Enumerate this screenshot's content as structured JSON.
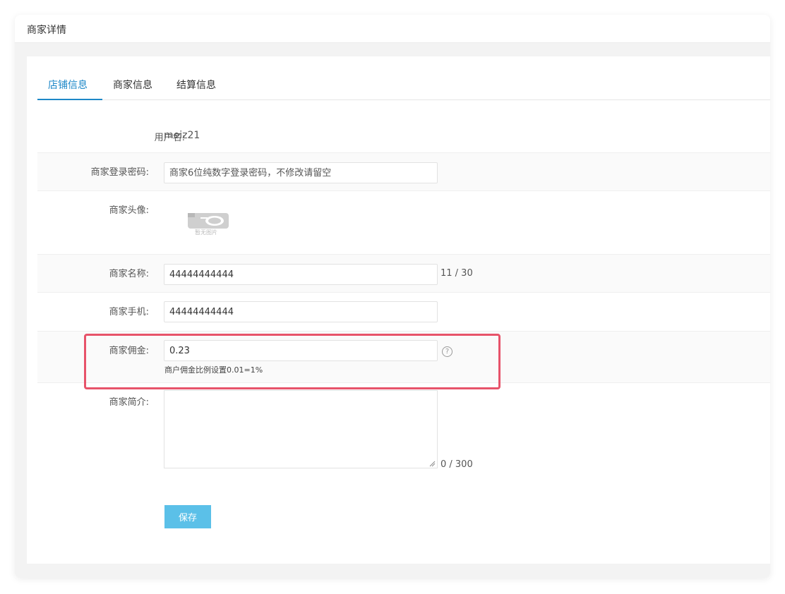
{
  "header": {
    "title": "商家详情"
  },
  "tabs": [
    {
      "label": "店铺信息",
      "active": true
    },
    {
      "label": "商家信息",
      "active": false
    },
    {
      "label": "结算信息",
      "active": false
    }
  ],
  "form": {
    "username": {
      "label": "用户名:",
      "value": "meiz21"
    },
    "password": {
      "label": "商家登录密码:",
      "placeholder": "商家6位纯数字登录密码，不修改请留空",
      "value": ""
    },
    "avatar": {
      "label": "商家头像:",
      "placeholder_text": "暂无图片",
      "icon": "camera-icon"
    },
    "name": {
      "label": "商家名称:",
      "value": "44444444444",
      "counter": "11 / 30"
    },
    "phone": {
      "label": "商家手机:",
      "value": "44444444444"
    },
    "commission": {
      "label": "商家佣金:",
      "value": "0.23",
      "hint": "商户佣金比例设置0.01=1%",
      "icon": "question-circle-icon"
    },
    "intro": {
      "label": "商家简介:",
      "value": "",
      "counter": "0 / 300"
    }
  },
  "actions": {
    "save_label": "保存"
  },
  "colors": {
    "accent": "#1e88c8",
    "button": "#5bc0e8",
    "highlight": "#e7536a"
  }
}
